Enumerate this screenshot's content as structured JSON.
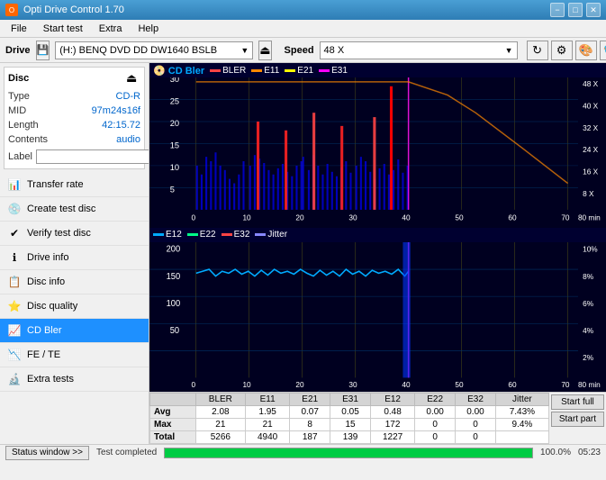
{
  "titlebar": {
    "title": "Opti Drive Control 1.70",
    "minimize": "−",
    "maximize": "□",
    "close": "✕"
  },
  "menubar": {
    "items": [
      "File",
      "Start test",
      "Extra",
      "Help"
    ]
  },
  "drivebar": {
    "drive_label": "Drive",
    "drive_value": "(H:)  BENQ DVD DD DW1640 BSLB",
    "speed_label": "Speed",
    "speed_value": "48 X"
  },
  "disc": {
    "title": "Disc",
    "type_label": "Type",
    "type_value": "CD-R",
    "mid_label": "MID",
    "mid_value": "97m24s16f",
    "length_label": "Length",
    "length_value": "42:15.72",
    "contents_label": "Contents",
    "contents_value": "audio",
    "label_label": "Label"
  },
  "nav": {
    "items": [
      {
        "id": "transfer-rate",
        "label": "Transfer rate",
        "icon": "📊"
      },
      {
        "id": "create-test-disc",
        "label": "Create test disc",
        "icon": "💿"
      },
      {
        "id": "verify-test-disc",
        "label": "Verify test disc",
        "icon": "✔"
      },
      {
        "id": "drive-info",
        "label": "Drive info",
        "icon": "ℹ"
      },
      {
        "id": "disc-info",
        "label": "Disc info",
        "icon": "📋"
      },
      {
        "id": "disc-quality",
        "label": "Disc quality",
        "icon": "⭐"
      },
      {
        "id": "cd-bler",
        "label": "CD Bler",
        "icon": "📈",
        "active": true
      },
      {
        "id": "fe-te",
        "label": "FE / TE",
        "icon": "📉"
      },
      {
        "id": "extra-tests",
        "label": "Extra tests",
        "icon": "🔬"
      }
    ]
  },
  "charts": {
    "upper": {
      "title": "CD Bler",
      "legend": [
        {
          "label": "BLER",
          "color": "#ff4444"
        },
        {
          "label": "E11",
          "color": "#ff8800"
        },
        {
          "label": "E21",
          "color": "#ffff00"
        },
        {
          "label": "E31",
          "color": "#ff00ff"
        }
      ],
      "ymax": 30,
      "xmax": 80,
      "y_right_labels": [
        "48 X",
        "40 X",
        "32 X",
        "24 X",
        "16 X",
        "8 X"
      ],
      "x_labels": [
        "0",
        "10",
        "20",
        "30",
        "40",
        "50",
        "60",
        "70",
        "80 min"
      ]
    },
    "lower": {
      "legend": [
        {
          "label": "E12",
          "color": "#00aaff"
        },
        {
          "label": "E22",
          "color": "#00ff88"
        },
        {
          "label": "E32",
          "color": "#ff4444"
        },
        {
          "label": "Jitter",
          "color": "#8888ff"
        }
      ],
      "ymax": 200,
      "xmax": 80,
      "y_right_labels": [
        "10%",
        "8%",
        "6%",
        "4%",
        "2%"
      ],
      "x_labels": [
        "0",
        "10",
        "20",
        "30",
        "40",
        "50",
        "60",
        "70",
        "80 min"
      ]
    }
  },
  "stats": {
    "columns": [
      "BLER",
      "E11",
      "E21",
      "E31",
      "E12",
      "E22",
      "E32",
      "Jitter"
    ],
    "rows": [
      {
        "label": "Avg",
        "values": [
          "2.08",
          "1.95",
          "0.07",
          "0.05",
          "0.48",
          "0.00",
          "0.00",
          "7.43%"
        ]
      },
      {
        "label": "Max",
        "values": [
          "21",
          "21",
          "8",
          "15",
          "172",
          "0",
          "0",
          "9.4%"
        ]
      },
      {
        "label": "Total",
        "values": [
          "5266",
          "4940",
          "187",
          "139",
          "1227",
          "0",
          "0",
          ""
        ]
      }
    ],
    "btn_start_full": "Start full",
    "btn_start_part": "Start part"
  },
  "statusbar": {
    "status_window_btn": "Status window >>",
    "status_text": "Test completed",
    "progress": 100.0,
    "progress_text": "100.0%",
    "time": "05:23"
  },
  "colors": {
    "accent": "#1e90ff",
    "active_nav": "#1e90ff",
    "chart_bg": "#000020",
    "grid_line": "#003366"
  }
}
